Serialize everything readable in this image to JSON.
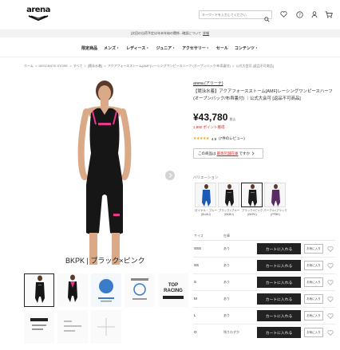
{
  "header": {
    "logo_text": "arena",
    "search_placeholder": "キーワードを入力してください"
  },
  "notice": {
    "text": "[次回の出荷予定は年末年始の関係...確認について",
    "link": "詳細"
  },
  "gnav": [
    "限定商品",
    "メンズ・",
    "レディース・",
    "ジュニア・",
    "アクセサリー・",
    "セール",
    "コンテンツ・"
  ],
  "breadcrumb": [
    "ホーム",
    ">",
    "DESCENTE STORE",
    ">",
    "すべて",
    ">",
    "[競泳水着]",
    ">",
    "アクアフォースストーム[AMF]レーシングワンピースハーフ (オープンバック/布帛裏付)",
    ">",
    "公式大会可 [返品不可商品]"
  ],
  "product": {
    "brand": "arena (アリーナ)",
    "title": "【競泳水着】アクアフォースストーム[AMF]レーシングワンピースハーフ(オープンバック/布帛裏付) ｜公式大会可 [返品不可商品]",
    "price": "¥43,780",
    "tax": "税込",
    "points": "1,990 ポイント獲得",
    "rating": "4.9",
    "reviews": "(7件のレビュー)",
    "stock_prefix": "この商品は",
    "stock_link": "最寄店舗在庫",
    "stock_suffix": "ですか",
    "color_caption": "BKPK | ブラック×ピンク",
    "variation_label": "バリエーション",
    "variations": [
      {
        "name": "ロイヤル・ブルー(BLMU)",
        "color": "#1c5bb5"
      },
      {
        "name": "ブラック×ブルー(BKBU)",
        "color": "#1b1b1b"
      },
      {
        "name": "ブラック×ピンク(BKPK)",
        "color": "#1b1b1b"
      },
      {
        "name": "パープル×ブラック(PPBK)",
        "color": "#5a2d62"
      }
    ],
    "size_header": [
      "サイズ",
      "在庫"
    ],
    "sizes": [
      {
        "size": "SSS",
        "stock": "あり"
      },
      {
        "size": "SS",
        "stock": "あり"
      },
      {
        "size": "S",
        "stock": "あり"
      },
      {
        "size": "M",
        "stock": "あり"
      },
      {
        "size": "L",
        "stock": "あり"
      },
      {
        "size": "O",
        "stock": "残りわずか"
      }
    ],
    "cart_label": "カートに入れる",
    "fav_label": "お気に入り"
  },
  "thumbnails": [
    "BKPK front",
    "BKPK back",
    "AQUA FORCE STORM",
    "WORLD AQUATICS",
    "TOP RACING",
    "logo",
    "tech",
    "more"
  ],
  "colors": {
    "accent_pink": "#e8378a",
    "text_red": "#d0291f",
    "star": "#f3a814",
    "button_dark": "#222222"
  }
}
